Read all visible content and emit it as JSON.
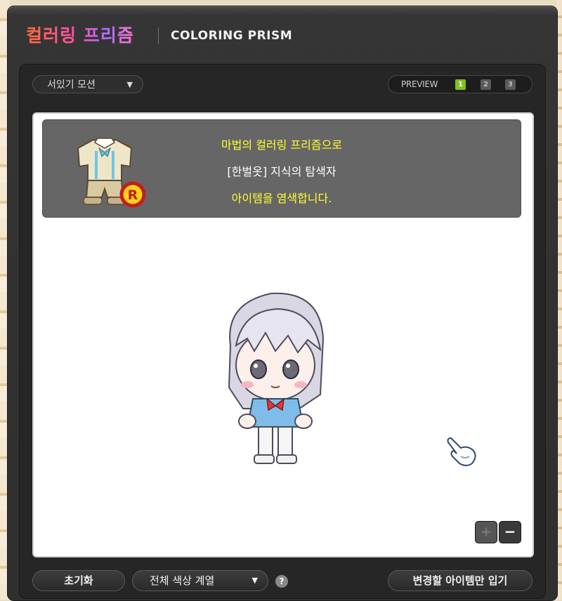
{
  "window": {
    "title_kr": "컬러링 프리즘",
    "title_en": "COLORING PRISM"
  },
  "top_bar": {
    "motion_select": {
      "value": "서있기 모션",
      "icon": "chevron-down-icon"
    },
    "preview": {
      "label": "PREVIEW",
      "buttons": [
        "1",
        "2",
        "3"
      ],
      "active_index": 0
    }
  },
  "banner": {
    "line1": "마법의 컬러링 프리즘으로",
    "line2": "[한벌옷] 지식의 탐색자",
    "line3": "아이템을 염색합니다.",
    "line1_color": "#ffff33",
    "line2_color": "#ffffff",
    "line3_color": "#ffff33",
    "item_icon": "overall-outfit-icon",
    "rarity_badge": "R"
  },
  "canvas": {
    "character": "chibi-character-silver-hair",
    "cursor": "glove-pointer-cursor",
    "zoom_in_label": "+",
    "zoom_out_label": "−"
  },
  "bottom_bar": {
    "reset_label": "초기화",
    "color_select": "전체 색상 계열",
    "help_label": "?",
    "apply_label": "변경할 아이템만 입기"
  },
  "colors": {
    "window_bg": "#2f2f2f",
    "canvas_bg": "#ffffff",
    "banner_bg": "#666666",
    "active_preview": "#7fc21d",
    "highlight_text": "#ffff33"
  }
}
